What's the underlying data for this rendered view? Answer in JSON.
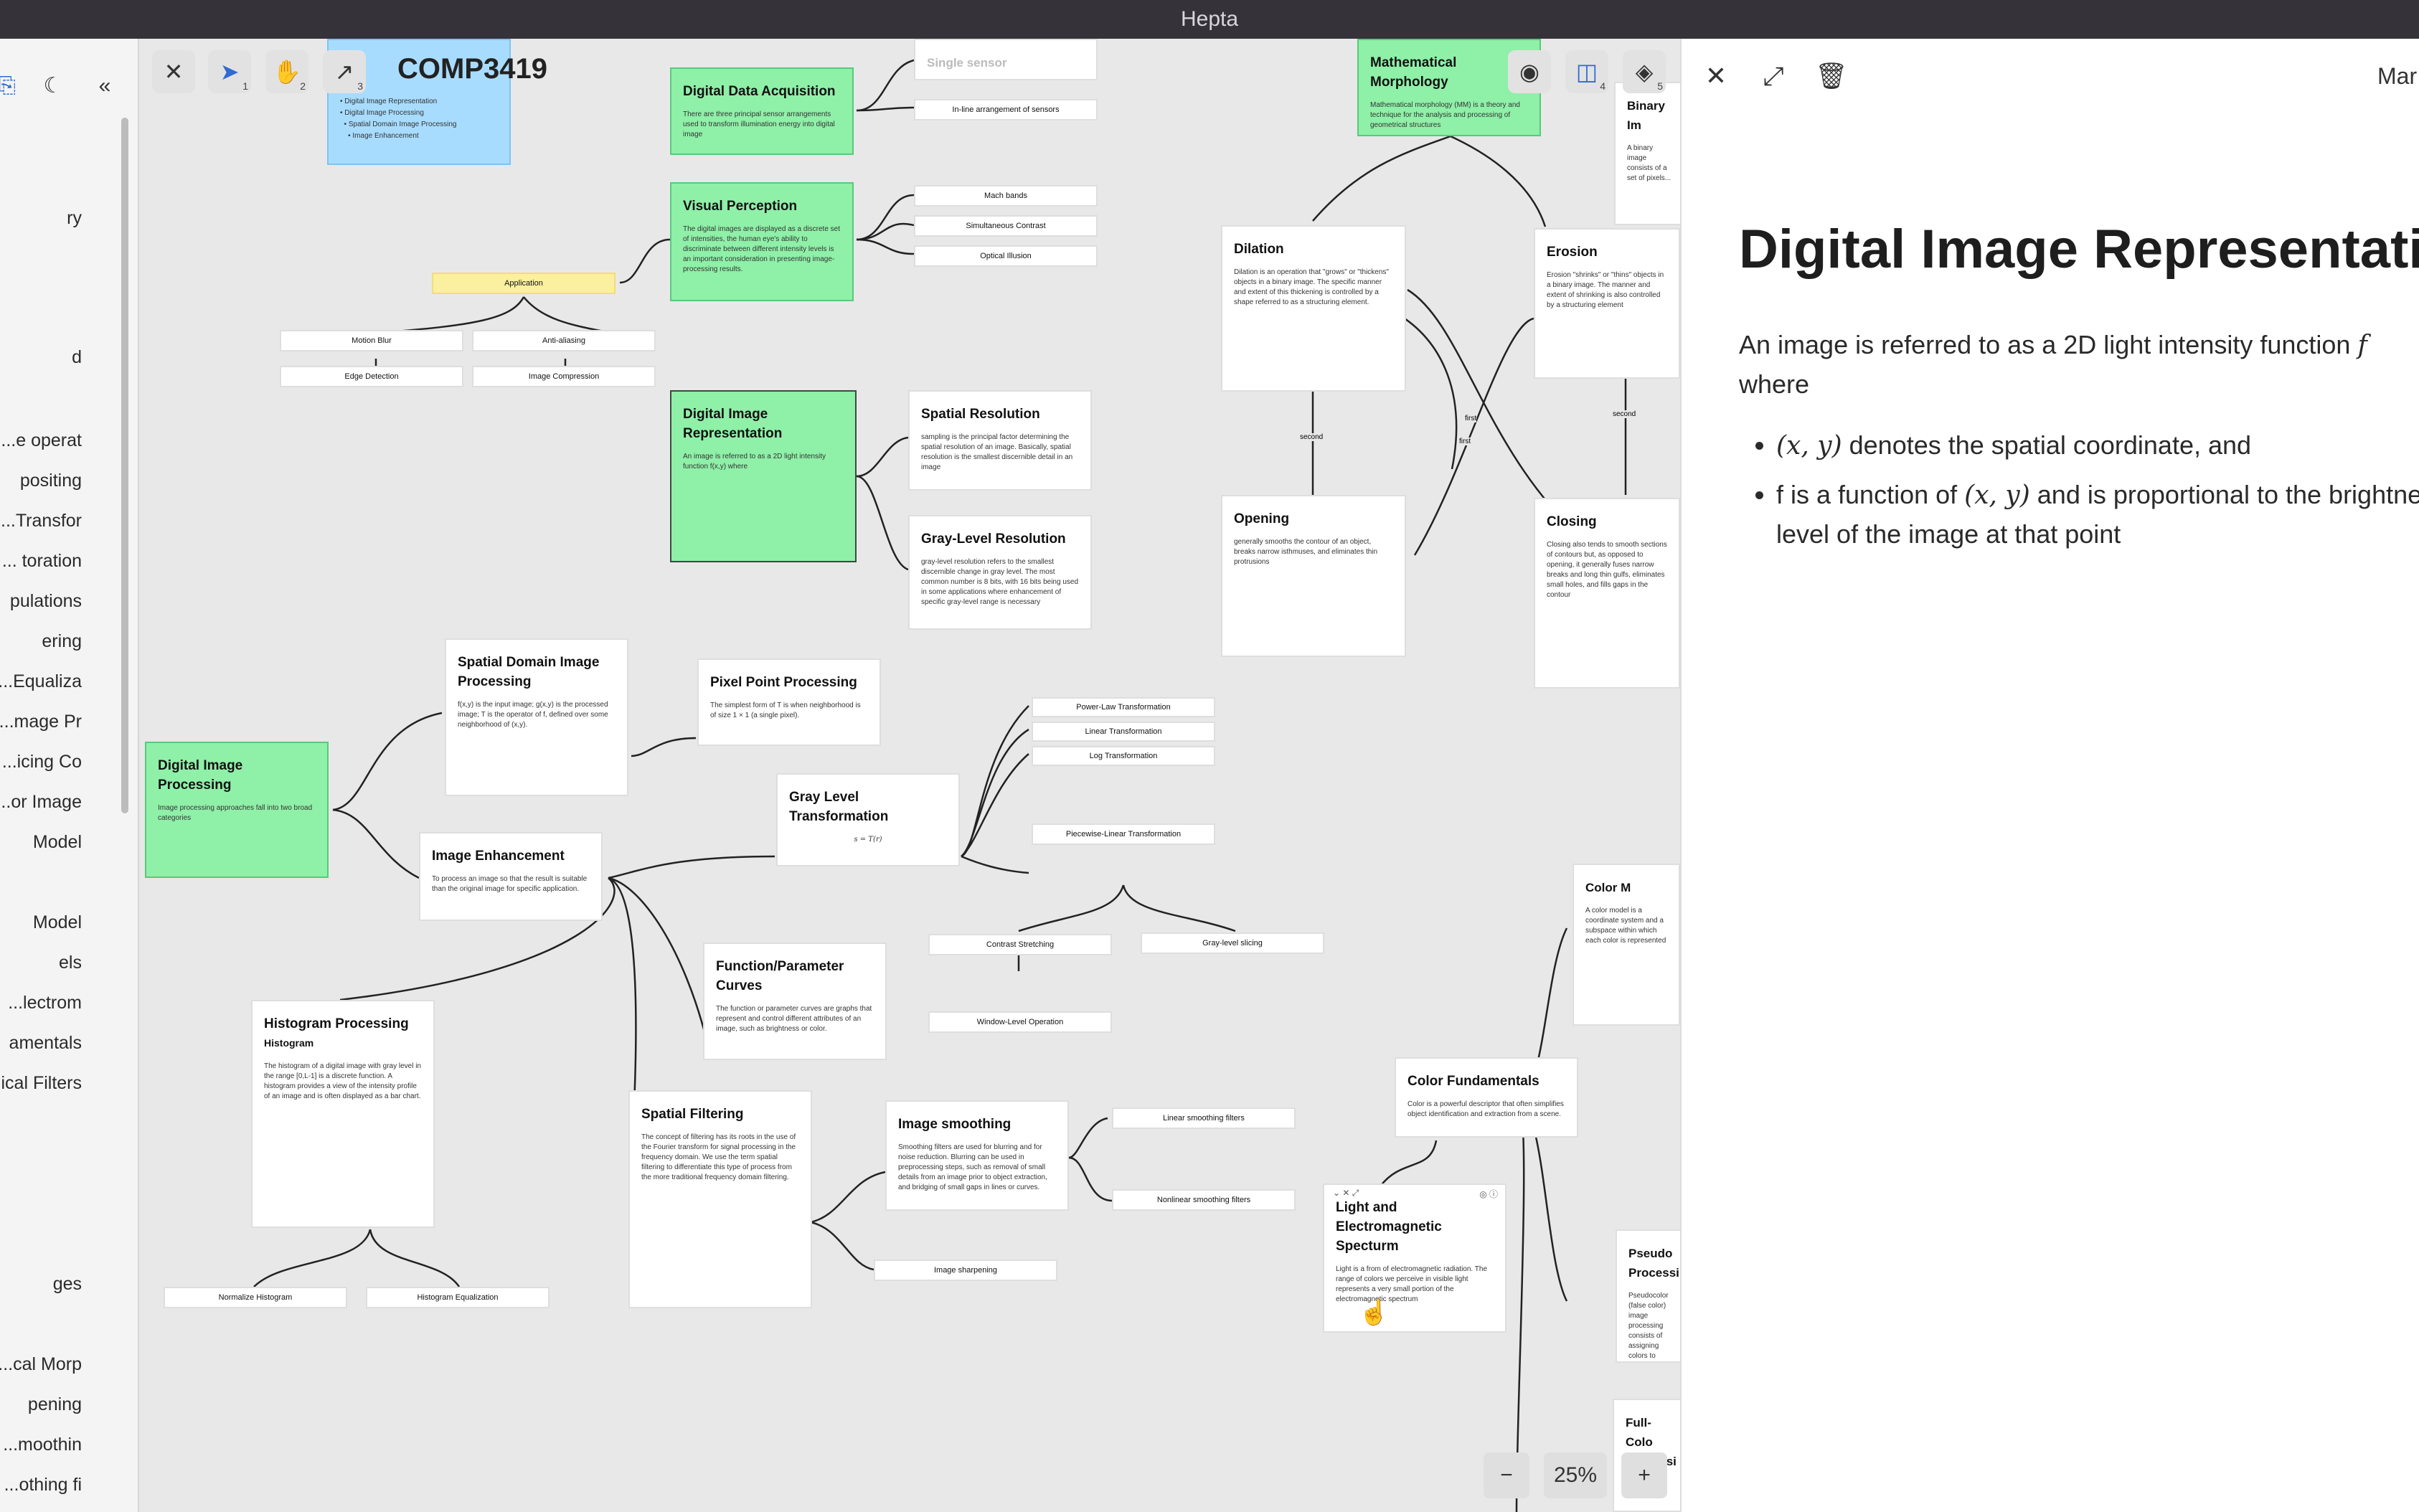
{
  "app": {
    "title": "Hepta"
  },
  "sidebar": {
    "items": [
      "ry",
      "d",
      "e operat...",
      "positing",
      "Transfor...",
      "toration ...",
      "pulations",
      "ering",
      "Equaliza...",
      "mage Pr...",
      "icing Co...",
      "or Image...",
      "Model",
      "Model",
      "els",
      "lectrom...",
      "amentals",
      "ical Filters",
      "ges",
      "cal Morp...",
      "pening",
      "moothin...",
      "othing fi..."
    ]
  },
  "toolbar": {
    "board_title": "COMP3419",
    "select_shortcut": "1",
    "hand_shortcut": "2",
    "arrow_shortcut": "3",
    "split_shortcut": "4",
    "layers_shortcut": "5",
    "zoom_level": "25%"
  },
  "canvas": {
    "nodes": {
      "n_top_blue_1": "Digital Image Representation",
      "n_top_blue_2": "Digital Image Processing",
      "n_top_blue_3": "Spatial Domain Image Processing",
      "n_top_blue_4": "Image Enhancement",
      "data_acq_title": "Digital Data Acquisition",
      "data_acq_desc": "There are three principal sensor arrangements used to transform illumination energy into digital image",
      "single_sensor": "Single sensor",
      "inline_sensors": "In-line arrangement of sensors",
      "visual_perception_title": "Visual Perception",
      "visual_perception_desc": "The digital images are displayed as a discrete set of intensities, the human eye's ability to discriminate between different intensity levels is an important consideration in presenting image-processing results.",
      "mach_bands": "Mach bands",
      "simultaneous_contrast": "Simultaneous Contrast",
      "optical_illusion": "Optical Illusion",
      "application": "Application",
      "motion_blur": "Motion Blur",
      "anti_aliasing": "Anti-aliasing",
      "edge_detection": "Edge Detection",
      "image_compression": "Image Compression",
      "dir_title": "Digital Image Representation",
      "dir_desc": "An image is referred to as a 2D light intensity function f(x,y) where",
      "spatial_res_title": "Spatial Resolution",
      "spatial_res_desc": "sampling is the principal factor determining the spatial resolution of an image. Basically, spatial resolution is the smallest discernible detail in an image",
      "gray_res_title": "Gray-Level Resolution",
      "gray_res_desc": "gray-level resolution refers to the smallest discernible change in gray level. The most common number is 8 bits, with 16 bits being used in some applications where enhancement of specific gray-level range is necessary",
      "dip_title": "Digital Image Processing",
      "dip_desc": "Image processing approaches fall into two broad categories",
      "sdip_title": "Spatial Domain Image Processing",
      "sdip_desc": "f(x,y) is the input image; g(x,y) is the processed image; T is the operator of f, defined over some neighborhood of (x,y).",
      "pixel_title": "Pixel Point Processing",
      "pixel_desc": "The simplest form of T is when neighborhood is of size 1 × 1 (a single pixel).",
      "ie_title": "Image Enhancement",
      "ie_desc": "To process an image so that the result is suitable than the original image for specific application.",
      "glt_title": "Gray Level Transformation",
      "glt_desc": "s = T(r)",
      "power_law": "Power-Law Transformation",
      "linear_t": "Linear Transformation",
      "log_t": "Log Transformation",
      "piecewise": "Piecewise-Linear Transformation",
      "contrast_stretch": "Contrast Stretching",
      "gray_slicing": "Gray-level slicing",
      "window_level": "Window-Level Operation",
      "func_title": "Function/Parameter Curves",
      "func_desc": "The function or parameter curves are graphs that represent and control different attributes of an image, such as brightness or color.",
      "hist_title": "Histogram Processing",
      "hist_sub": "Histogram",
      "hist_desc": "The histogram of a digital image with gray level in the range [0,L-1] is a discrete function. A histogram provides a view of the intensity profile of an image and is often displayed as a bar chart.",
      "normalize_hist": "Normalize Histogram",
      "hist_eq": "Histogram Equalization",
      "sf_title": "Spatial Filtering",
      "sf_desc": "The concept of filtering has its roots in the use of the Fourier transform for signal processing in the frequency domain. We use the term spatial filtering to differentiate this type of process from the more traditional frequency domain filtering.",
      "smooth_title": "Image smoothing",
      "smooth_desc": "Smoothing filters are used for blurring and for noise reduction. Blurring can be used in preprocessing steps, such as removal of small details from an image prior to object extraction, and bridging of small gaps in lines or curves.",
      "linear_smooth": "Linear smoothing filters",
      "nonlinear_smooth": "Nonlinear smoothing filters",
      "sharpening": "Image sharpening",
      "morph_title": "Mathematical Morphology",
      "morph_desc": "Mathematical morphology (MM) is a theory and technique for the analysis and processing of geometrical structures",
      "binary_title": "Binary Im",
      "binary_desc": "A binary image consists of a set of pixels...",
      "dilation_title": "Dilation",
      "dilation_desc": "Dilation is an operation that \"grows\" or \"thickens\" objects in a binary image. The specific manner and extent of this thickening is controlled by a shape referred to as a structuring element.",
      "erosion_title": "Erosion",
      "erosion_desc": "Erosion \"shrinks\" or \"thins\" objects in a binary image. The manner and extent of shrinking is also controlled by a structuring element",
      "opening_title": "Opening",
      "opening_desc": "generally smooths the contour of an object, breaks narrow isthmuses, and eliminates thin protrusions",
      "closing_title": "Closing",
      "closing_desc": "Closing also tends to smooth sections of contours but, as opposed to opening, it generally fuses narrow breaks and long thin gulfs, eliminates small holes, and fills gaps in the contour",
      "edge_second_1": "second",
      "edge_first_1": "first",
      "edge_first_2": "first",
      "edge_second_2": "second",
      "color_fund_title": "Color Fundamentals",
      "color_fund_desc": "Color is a powerful descriptor that often simplifies object identification and extraction from a scene.",
      "color_model_title": "Color M",
      "color_model_desc": "A color model is a coordinate system and a subspace within which each color is represented",
      "light_title": "Light and Electromagnetic Specturm",
      "light_desc": "Light is a from of electromagnetic radiation. The range of colors we perceive in visible light represents a very small portion of the electromagnetic spectrum",
      "pseudo_title": "Pseudo Processi",
      "pseudo_desc": "Pseudocolor (false color) image processing consists of assigning colors to gray values based on a specified criterion",
      "fullcolor_title": "Full-Colo Processi"
    }
  },
  "panel": {
    "title": "Digital Image Representation",
    "cropped_right_label": "Mar",
    "intro": "An image is referred to as a 2D light intensity function",
    "intro_math": "f",
    "intro_where": "where",
    "bullet1_math": "(x, y)",
    "bullet1_text": " denotes the spatial coordinate, and",
    "bullet2_pre": "f is a function of ",
    "bullet2_math": "(x, y)",
    "bullet2_post": " and is proportional to the brightness or grey level of the image at that point"
  }
}
